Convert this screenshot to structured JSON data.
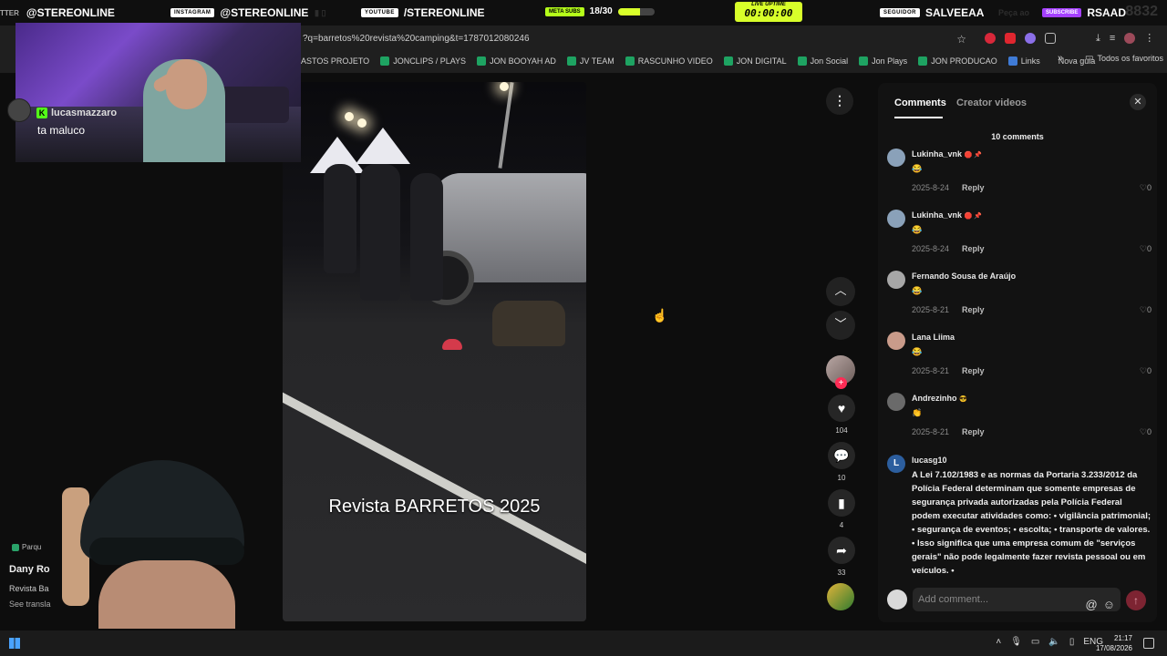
{
  "stream_bar": {
    "twitter_fragment": "TTER",
    "twitter_handle": "@STEREONLINE",
    "instagram_tag": "INSTAGRAM",
    "instagram_handle": "@STEREONLINE",
    "youtube_tag": "YOUTUBE",
    "youtube_handle": "/STEREONLINE",
    "meta_tag": "META SUBS",
    "meta_count": "18/30",
    "meta_progress": 0.6,
    "uptime_label": "LIVE UPTIME",
    "uptime_value": "00:00:00",
    "follower_tag": "SEGUIDOR",
    "follower_name": "SALVEEAA",
    "sub_tag": "SUBSCRIBE",
    "sub_name": "RSAAD",
    "ghost_number": "8832",
    "ghost_text": "Peça ao"
  },
  "browser": {
    "url": "?q=barretos%20revista%20camping&t=1787012080246",
    "bookmarks": [
      {
        "label": "ASTOS PROJETO",
        "icon": "none"
      },
      {
        "label": "JONCLIPS / PLAYS",
        "icon": "sheet"
      },
      {
        "label": "JON BOOYAH AD",
        "icon": "sheet"
      },
      {
        "label": "JV TEAM",
        "icon": "sheet"
      },
      {
        "label": "RASCUNHO VIDEO",
        "icon": "sheet"
      },
      {
        "label": "JON DIGITAL",
        "icon": "sheet"
      },
      {
        "label": "Jon Social",
        "icon": "sheet"
      },
      {
        "label": "Jon Plays",
        "icon": "sheet"
      },
      {
        "label": "JON PRODUCAO",
        "icon": "sheet"
      },
      {
        "label": "Links",
        "icon": "blue"
      },
      {
        "label": "Nova guia",
        "icon": "none"
      }
    ],
    "favorites_label": "Todos os favoritos"
  },
  "webcam_chat": {
    "username": "lucasmazzaro",
    "message": "ta maluco"
  },
  "left_info": {
    "chip": "Parqu",
    "name": "Dany Ro",
    "desc": "Revista Ba",
    "see_translation": "See transla"
  },
  "video": {
    "caption": "Revista BARRETOS 2025"
  },
  "actions": {
    "likes": "104",
    "comments": "10",
    "saves": "4",
    "shares": "33"
  },
  "panel": {
    "tab_comments": "Comments",
    "tab_creator": "Creator videos",
    "comment_count": "10 comments",
    "reply_label": "Reply",
    "comments": [
      {
        "user": "Lukinha_vnk",
        "badges": "🛑 📌",
        "text": "😂",
        "date": "2025-8-24",
        "likes": "0"
      },
      {
        "user": "Lukinha_vnk",
        "badges": "🛑 📌",
        "text": "😂",
        "date": "2025-8-24",
        "likes": "0"
      },
      {
        "user": "Fernando Sousa de Araújo",
        "badges": "",
        "text": "😂",
        "date": "2025-8-21",
        "likes": "0"
      },
      {
        "user": "Lana Liima",
        "badges": "",
        "text": "😂",
        "date": "2025-8-21",
        "likes": "0"
      },
      {
        "user": "Andrezinho",
        "badges": "😎",
        "text": "👏",
        "date": "2025-8-21",
        "likes": "0"
      }
    ],
    "long_comment": {
      "user": "lucasg10",
      "avatar_letter": "L",
      "text": "A Lei 7.102/1983 e as normas da Portaria 3.233/2012 da Polícia Federal determinam que somente empresas de segurança privada autorizadas pela Polícia Federal podem executar atividades como: • vigilância patrimonial; • segurança de eventos; • escolta; • transporte de valores. • Isso significa que uma empresa comum de \"serviços gerais\" não pode legalmente fazer revista pessoal ou em veículos. •"
    },
    "add_placeholder": "Add comment..."
  },
  "taskbar": {
    "lang": "ENG",
    "time": "21:17",
    "date": "17/08/2026"
  },
  "colors": {
    "accent_lime": "#d8ff2a",
    "tiktok_red": "#fe2c55",
    "panel_bg": "#121212"
  }
}
